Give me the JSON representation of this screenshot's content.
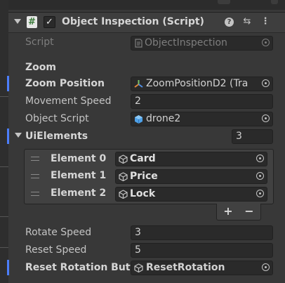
{
  "header": {
    "title": "Object Inspection (Script)",
    "enabled_mark": "✓",
    "script_icon_glyph": "#",
    "help_icon_glyph": "?",
    "presets_icon_glyph": "⇆",
    "menu_icon_glyph": "⋮"
  },
  "script_row": {
    "label": "Script",
    "value": "ObjectInspection"
  },
  "section": {
    "label": "Zoom"
  },
  "zoom_position": {
    "label": "Zoom Position",
    "value": "ZoomPositionD2 (Tra"
  },
  "movement_speed": {
    "label": "Movement Speed",
    "value": "2"
  },
  "object_script": {
    "label": "Object Script",
    "value": "drone2"
  },
  "ui_elements": {
    "label": "UiElements",
    "count": "3",
    "items": [
      {
        "label": "Element 0",
        "value": "Card"
      },
      {
        "label": "Element 1",
        "value": "Price"
      },
      {
        "label": "Element 2",
        "value": "Lock"
      }
    ],
    "add_label": "+",
    "remove_label": "−"
  },
  "rotate_speed": {
    "label": "Rotate Speed",
    "value": "3"
  },
  "reset_speed": {
    "label": "Reset Speed",
    "value": "5"
  },
  "reset_rotation_button": {
    "label": "Reset Rotation Butto",
    "value": "ResetRotation"
  },
  "colors": {
    "background": "#383838",
    "field": "#2a2a2a",
    "accent_blue": "#4c7efd",
    "text": "#c4c4c4"
  }
}
